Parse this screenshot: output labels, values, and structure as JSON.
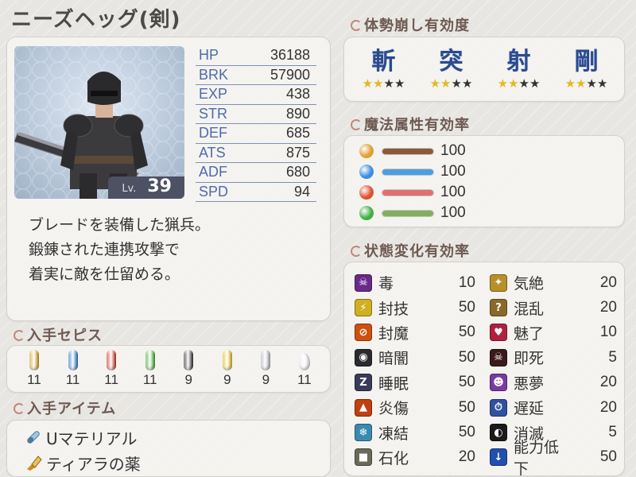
{
  "character": {
    "title": "ニーズヘッグ(剣)",
    "level_label": "Lv.",
    "level": "39",
    "description": [
      "ブレードを装備した猟兵。",
      "鍛錬された連携攻撃で",
      "着実に敵を仕留める。"
    ]
  },
  "stats": [
    {
      "key": "HP",
      "value": "36188"
    },
    {
      "key": "BRK",
      "value": "57900"
    },
    {
      "key": "EXP",
      "value": "438"
    },
    {
      "key": "STR",
      "value": "890"
    },
    {
      "key": "DEF",
      "value": "685"
    },
    {
      "key": "ATS",
      "value": "875"
    },
    {
      "key": "ADF",
      "value": "680"
    },
    {
      "key": "SPD",
      "value": "94"
    }
  ],
  "break": {
    "title": "体勢崩し有効度",
    "items": [
      {
        "label": "斬",
        "stars": 2,
        "max": 4
      },
      {
        "label": "突",
        "stars": 2,
        "max": 4
      },
      {
        "label": "射",
        "stars": 2,
        "max": 4
      },
      {
        "label": "剛",
        "stars": 2,
        "max": 4
      }
    ]
  },
  "magic": {
    "title": "魔法属性有効率",
    "items": [
      {
        "element": "earth-icon",
        "color": "#e0a030",
        "bar_color": "#8a5a3a",
        "value": "100",
        "fill": 1.0
      },
      {
        "element": "water-icon",
        "color": "#3a8fe0",
        "bar_color": "#4a9fe0",
        "value": "100",
        "fill": 1.0
      },
      {
        "element": "fire-icon",
        "color": "#e05030",
        "bar_color": "#e07070",
        "value": "100",
        "fill": 1.0
      },
      {
        "element": "wind-icon",
        "color": "#40b040",
        "bar_color": "#7fb060",
        "value": "100",
        "fill": 1.0
      }
    ]
  },
  "status": {
    "title": "状態変化有効率",
    "items": [
      {
        "name": "毒",
        "value": "10",
        "icon": "poison-icon",
        "color": "#6a2a8a"
      },
      {
        "name": "気絶",
        "value": "20",
        "icon": "faint-icon",
        "color": "#b8902a"
      },
      {
        "name": "封技",
        "value": "50",
        "icon": "seal-skill-icon",
        "color": "#d0b020"
      },
      {
        "name": "混乱",
        "value": "20",
        "icon": "confusion-icon",
        "color": "#8a6a2a"
      },
      {
        "name": "封魔",
        "value": "50",
        "icon": "seal-magic-icon",
        "color": "#d05010"
      },
      {
        "name": "魅了",
        "value": "10",
        "icon": "charm-icon",
        "color": "#b02040"
      },
      {
        "name": "暗闇",
        "value": "50",
        "icon": "blind-icon",
        "color": "#2a2a30"
      },
      {
        "name": "即死",
        "value": "5",
        "icon": "death-icon",
        "color": "#3a1a1a"
      },
      {
        "name": "睡眠",
        "value": "50",
        "icon": "sleep-icon",
        "color": "#3a3a5a"
      },
      {
        "name": "悪夢",
        "value": "20",
        "icon": "nightmare-icon",
        "color": "#7a3aa0"
      },
      {
        "name": "炎傷",
        "value": "50",
        "icon": "burn-icon",
        "color": "#c04010"
      },
      {
        "name": "遅延",
        "value": "20",
        "icon": "delay-icon",
        "color": "#3050a0"
      },
      {
        "name": "凍結",
        "value": "50",
        "icon": "freeze-icon",
        "color": "#3a8ab0"
      },
      {
        "name": "消滅",
        "value": "5",
        "icon": "vanish-icon",
        "color": "#1a1a1a"
      },
      {
        "name": "石化",
        "value": "20",
        "icon": "petrify-icon",
        "color": "#6a6a5a"
      },
      {
        "name": "能力低下",
        "value": "50",
        "icon": "stat-down-icon",
        "color": "#2050b0"
      }
    ]
  },
  "sepis": {
    "title": "入手セピス",
    "items": [
      {
        "name": "earth-sepith-icon",
        "color": "#d6a020",
        "count": "11",
        "shape": "capsule"
      },
      {
        "name": "water-sepith-icon",
        "color": "#2a7ad0",
        "count": "11",
        "shape": "capsule"
      },
      {
        "name": "fire-sepith-icon",
        "color": "#d03020",
        "count": "11",
        "shape": "capsule"
      },
      {
        "name": "wind-sepith-icon",
        "color": "#40b030",
        "count": "11",
        "shape": "capsule"
      },
      {
        "name": "time-sepith-icon",
        "color": "#303030",
        "count": "9",
        "shape": "capsule"
      },
      {
        "name": "space-sepith-icon",
        "color": "#e0c020",
        "count": "9",
        "shape": "capsule"
      },
      {
        "name": "mirage-sepith-icon",
        "color": "#b8b8c0",
        "count": "9",
        "shape": "capsule"
      },
      {
        "name": "mass-sepith-icon",
        "color": "#e8e8f0",
        "count": "11",
        "shape": "drop"
      }
    ]
  },
  "items_section": {
    "title": "入手アイテム",
    "items": [
      {
        "name": "Uマテリアル",
        "icon": "material-icon"
      },
      {
        "name": "ティアラの薬",
        "icon": "medicine-icon"
      }
    ]
  }
}
